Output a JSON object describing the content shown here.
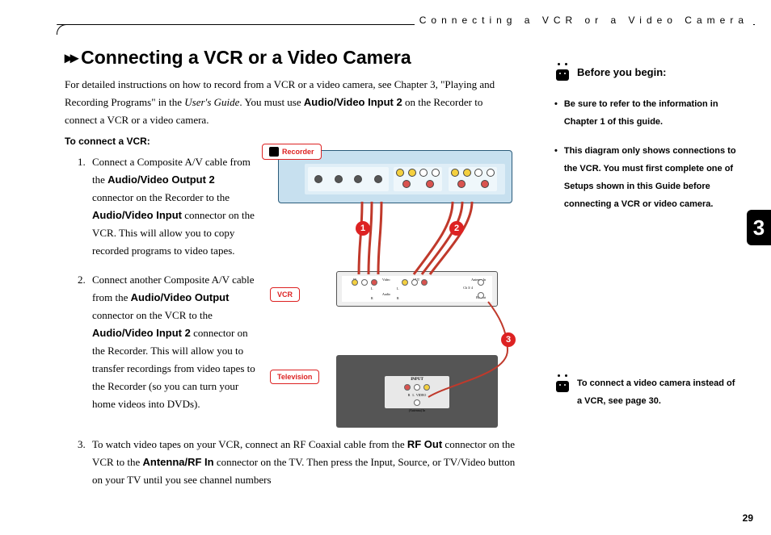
{
  "running_head": "Connecting a VCR or a Video Camera",
  "title": "Connecting a VCR or a Video Camera",
  "intro": {
    "p1a": "For detailed instructions on how to record from a VCR or a video camera, see Chapter 3, \"Playing and Recording Programs\" in the ",
    "p1_italic": "User's Guide",
    "p1b": ". You must use ",
    "p1_bold": "Audio/Video Input 2",
    "p1c": " on the Recorder to connect a VCR or a video camera."
  },
  "subhead": "To connect a VCR:",
  "steps": {
    "s1": {
      "n": "1.",
      "a": "Connect a Composite A/V cable from the ",
      "b1": "Audio/Video Output 2",
      "b": " connector on the Recorder to the ",
      "b2": "Audio/Video Input",
      "c": " connector on the VCR. This will allow you to copy recorded programs to video tapes."
    },
    "s2": {
      "n": "2.",
      "a": "Connect another Composite A/V cable from the ",
      "b1": "Audio/Video Output",
      "b": " connector on the VCR to the ",
      "b2": "Audio/Video Input 2",
      "c": " connector on the Recorder. This will allow you to transfer recordings from video tapes to the Recorder (so you can turn your home videos into DVDs)."
    },
    "s3": {
      "n": "3.",
      "a": "To watch video tapes on your VCR, connect an RF Coaxial cable from the ",
      "b1": "RF Out",
      "b": " connector on the VCR to the ",
      "b2": "Antenna/RF In",
      "c": " connector on the TV. Then press the Input, Source, or TV/Video button on your TV until you see channel numbers"
    }
  },
  "sidebar": {
    "head": "Before you begin:",
    "items": [
      "Be sure to refer to the information in Chapter 1 of this guide.",
      "This diagram only shows connections to the VCR. You must first complete one of Setups shown in this Guide before connecting a VCR or video camera."
    ],
    "note": "To connect a video camera instead of a VCR, see page 30."
  },
  "diagram": {
    "labels": {
      "recorder": "Recorder",
      "vcr": "VCR",
      "television": "Television",
      "tv_input": "INPUT",
      "tv_antenna": "(Antenna) In",
      "vcr_in": "IN",
      "vcr_out": "OUT",
      "vcr_video": "Video",
      "vcr_audio": "Audio",
      "vcr_antenna": "Antenna In",
      "vcr_ch": "Ch 3/ 4",
      "vcr_rf": "RF Out",
      "l": "L",
      "r": "R",
      "video": "VIDEO"
    },
    "badges": {
      "b1": "1",
      "b2": "2",
      "b3": "3"
    }
  },
  "page_number": "29",
  "chapter_tab": "3"
}
